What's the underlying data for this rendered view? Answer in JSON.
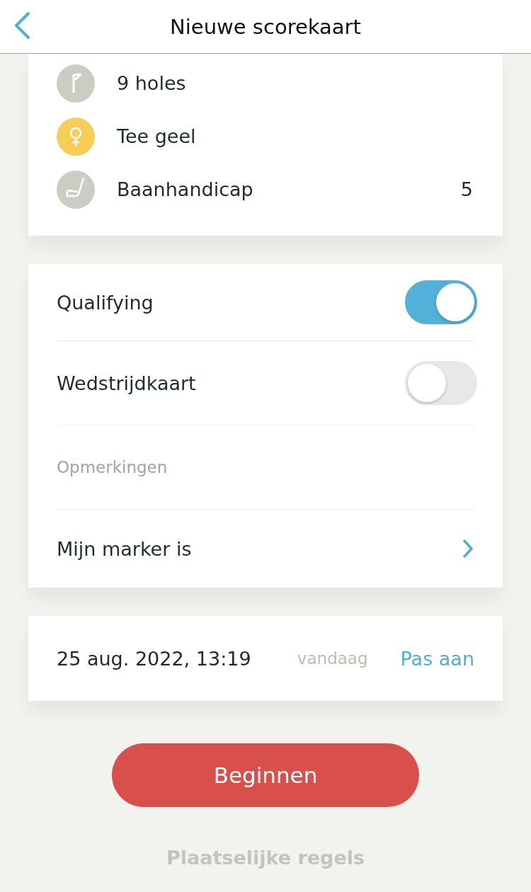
{
  "header": {
    "title": "Nieuwe scorekaart"
  },
  "course_details": [
    {
      "kind": "flag",
      "color": "#cdccc3",
      "label": "9 holes"
    },
    {
      "kind": "tee",
      "color": "#f5cd57",
      "label": "Tee geel"
    },
    {
      "kind": "club",
      "color": "#cdccc3",
      "label": "Baanhandicap",
      "value": "5"
    }
  ],
  "settings": [
    {
      "kind": "toggle",
      "label": "Qualifying",
      "on": true
    },
    {
      "kind": "toggle",
      "label": "Wedstrijdkaart",
      "on": false
    },
    {
      "kind": "field",
      "placeholder": "Opmerkingen"
    },
    {
      "kind": "link",
      "label": "Mijn marker is"
    }
  ],
  "date_card": {
    "datetime": "25 aug. 2022, 13:19",
    "note": "vandaag",
    "action": "Pas aan"
  },
  "start_button": "Beginnen",
  "footer_link": "Plaatselijke regels"
}
